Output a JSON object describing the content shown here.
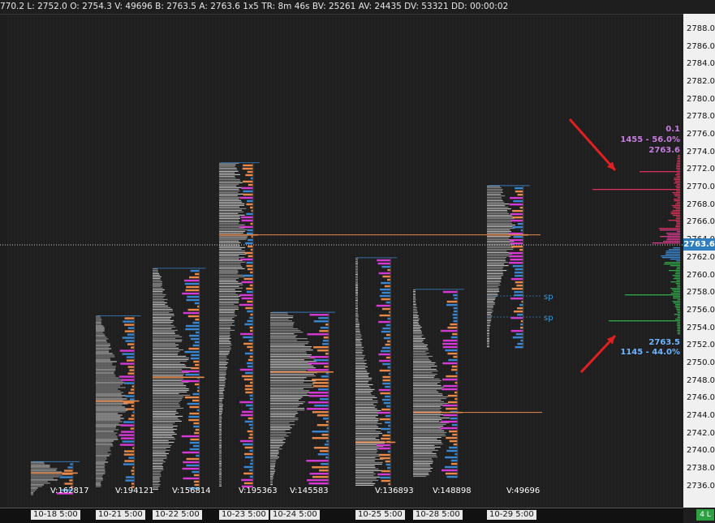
{
  "status_line": "770.2 L: 2752.0 O: 2754.3 V: 49696 B: 2763.5 A: 2763.6 1x5 TR: 8m 46s BV: 25261 AV: 24435 DV: 53321 DD: 00:00:02",
  "current_price": "2763.6",
  "badge": "4 L",
  "colors": {
    "bg": "#1e1e1e",
    "buy": "#3a86d0",
    "sell": "#e8894a",
    "poc": "#e8894a",
    "hv": "#d53ad5",
    "ask_hist": "#d9305a",
    "bid_hist": "#2fa84a",
    "arrow": "#e02020"
  },
  "chart_data": {
    "type": "volume_profile",
    "y_range": [
      2735,
      2789.2
    ],
    "y_ticks": [
      "2788.0",
      "2786.0",
      "2784.0",
      "2782.0",
      "2780.0",
      "2778.0",
      "2776.0",
      "2774.0",
      "2772.0",
      "2770.0",
      "2768.0",
      "2766.0",
      "2764.0",
      "2762.0",
      "2760.0",
      "2758.0",
      "2756.0",
      "2754.0",
      "2752.0",
      "2750.0",
      "2748.0",
      "2746.0",
      "2744.0",
      "2742.0",
      "2740.0",
      "2738.0",
      "2736.0"
    ],
    "sessions": [
      {
        "date": "10-18  5:00",
        "volume_label": "V:162817",
        "low": 2735.0,
        "high": 2738.8,
        "poc": 2737.5
      },
      {
        "date": "10-21  5:00",
        "volume_label": "V:194121",
        "low": 2736.0,
        "high": 2755.4,
        "poc": 2745.7
      },
      {
        "date": "10-22  5:00",
        "volume_label": "V:156814",
        "low": 2735.6,
        "high": 2760.8,
        "poc": 2748.4
      },
      {
        "date": "10-23  5:00",
        "volume_label": "V:195363",
        "low": 2736.0,
        "high": 2772.8,
        "poc": 2764.6
      },
      {
        "date": "10-24  5:00",
        "volume_label": "V:145583",
        "low": 2736.2,
        "high": 2755.8,
        "poc": 2749.0
      },
      {
        "date": "10-25  5:00",
        "volume_label": "V:136893",
        "low": 2736.0,
        "high": 2762.0,
        "poc": 2741.0
      },
      {
        "date": "10-28  5:00",
        "volume_label": "V:148898",
        "low": 2737.0,
        "high": 2758.4,
        "poc": 2744.4
      },
      {
        "date": "10-29  5:00",
        "volume_label": "V:49696",
        "low": 2751.8,
        "high": 2770.2,
        "poc": 2764.6
      }
    ],
    "sp_markers": [
      "sp",
      "sp"
    ],
    "dom_annotations": {
      "ask_top": "0.1",
      "ask_pct": "1455 - 56.0%",
      "ask_price": "2763.6",
      "bid_price": "2763.5",
      "bid_pct": "1145 - 44.0%"
    }
  }
}
